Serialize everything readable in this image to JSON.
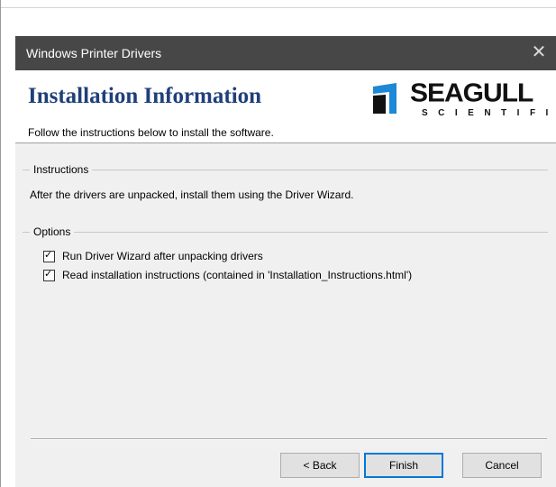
{
  "window": {
    "title": "Windows Printer Drivers",
    "close_glyph": "✕",
    "close_icon": "close-icon"
  },
  "header": {
    "heading": "Installation Information",
    "subtitle": "Follow the instructions below to install the software.",
    "logo": {
      "word": "SEAGULL",
      "sub": "SCIENTIFIC",
      "icon": "seagull-logo-mark",
      "mark_color": "#1d88d6"
    }
  },
  "instructions": {
    "group_label": "Instructions",
    "text": "After the drivers are unpacked, install them using the Driver Wizard."
  },
  "options": {
    "group_label": "Options",
    "items": [
      {
        "label": "Run Driver Wizard after unpacking drivers",
        "checked": true
      },
      {
        "label": "Read installation instructions (contained in 'Installation_Instructions.html')",
        "checked": true
      }
    ]
  },
  "buttons": {
    "back": "< Back",
    "finish": "Finish",
    "cancel": "Cancel"
  },
  "colors": {
    "titlebar": "#474747",
    "heading": "#1f3f7a",
    "focus": "#0078d7"
  }
}
